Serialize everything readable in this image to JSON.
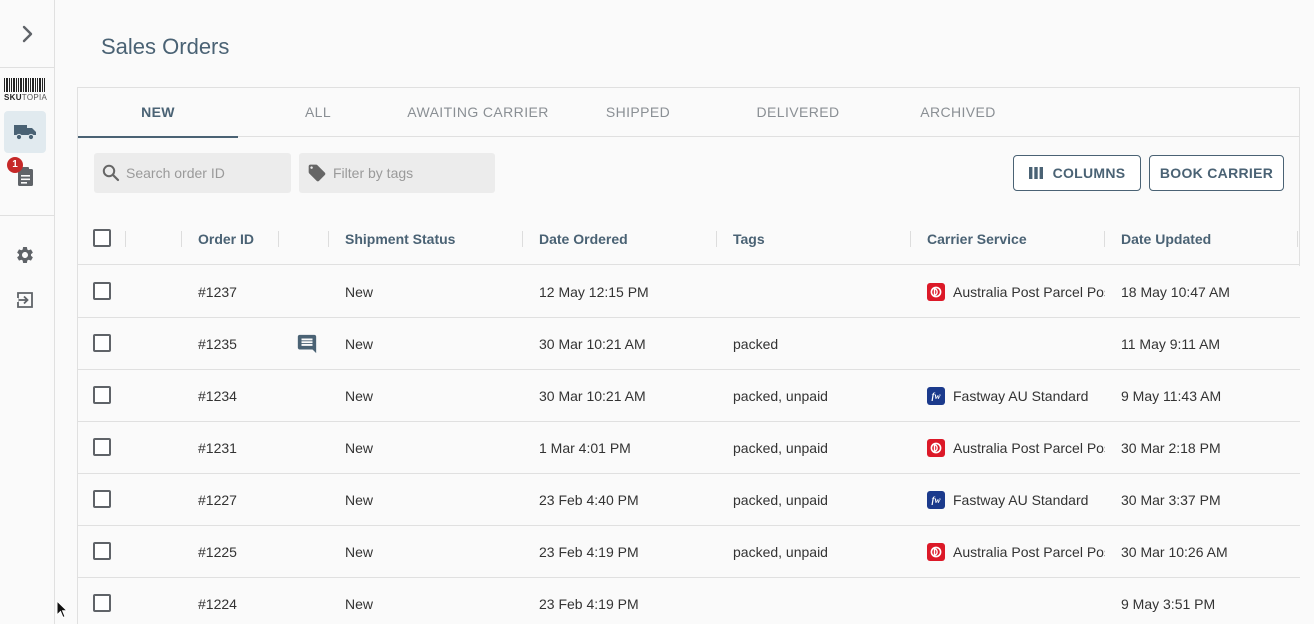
{
  "brand": {
    "name_bold": "SKU",
    "name_light": "TOPIA",
    "badge_count": "1"
  },
  "page": {
    "title": "Sales Orders"
  },
  "tabs": [
    {
      "label": "New",
      "active": true
    },
    {
      "label": "All",
      "active": false
    },
    {
      "label": "Awaiting Carrier",
      "active": false
    },
    {
      "label": "Shipped",
      "active": false
    },
    {
      "label": "Delivered",
      "active": false
    },
    {
      "label": "Archived",
      "active": false
    }
  ],
  "toolbar": {
    "search_placeholder": "Search order ID",
    "tags_placeholder": "Filter by tags",
    "columns_label": "COLUMNS",
    "book_carrier_label": "BOOK CARRIER"
  },
  "table": {
    "headers": {
      "order_id": "Order ID",
      "shipment_status": "Shipment Status",
      "date_ordered": "Date Ordered",
      "tags": "Tags",
      "carrier_service": "Carrier Service",
      "date_updated": "Date Updated"
    },
    "rows": [
      {
        "order_id": "#1237",
        "has_comment": false,
        "status": "New",
        "date_ordered": "12 May 12:15 PM",
        "tags": "",
        "carrier": "auspost",
        "carrier_service": "Australia Post Parcel Post",
        "date_updated": "18 May 10:47 AM"
      },
      {
        "order_id": "#1235",
        "has_comment": true,
        "status": "New",
        "date_ordered": "30 Mar 10:21 AM",
        "tags": "packed",
        "carrier": "",
        "carrier_service": "",
        "date_updated": "11 May 9:11 AM"
      },
      {
        "order_id": "#1234",
        "has_comment": false,
        "status": "New",
        "date_ordered": "30 Mar 10:21 AM",
        "tags": "packed, unpaid",
        "carrier": "fastway",
        "carrier_service": "Fastway AU Standard",
        "date_updated": "9 May 11:43 AM"
      },
      {
        "order_id": "#1231",
        "has_comment": false,
        "status": "New",
        "date_ordered": "1 Mar 4:01 PM",
        "tags": "packed, unpaid",
        "carrier": "auspost",
        "carrier_service": "Australia Post Parcel Post",
        "date_updated": "30 Mar 2:18 PM"
      },
      {
        "order_id": "#1227",
        "has_comment": false,
        "status": "New",
        "date_ordered": "23 Feb 4:40 PM",
        "tags": "packed, unpaid",
        "carrier": "fastway",
        "carrier_service": "Fastway AU Standard",
        "date_updated": "30 Mar 3:37 PM"
      },
      {
        "order_id": "#1225",
        "has_comment": false,
        "status": "New",
        "date_ordered": "23 Feb 4:19 PM",
        "tags": "packed, unpaid",
        "carrier": "auspost",
        "carrier_service": "Australia Post Parcel Post",
        "date_updated": "30 Mar 10:26 AM"
      },
      {
        "order_id": "#1224",
        "has_comment": false,
        "status": "New",
        "date_ordered": "23 Feb 4:19 PM",
        "tags": "",
        "carrier": "",
        "carrier_service": "",
        "date_updated": "9 May 3:51 PM"
      }
    ]
  },
  "icons": {
    "expand": "chevron-right-icon",
    "barcode": "barcode-logo",
    "orders": "truck-icon",
    "inventory": "clipboard-icon",
    "settings": "gear-icon",
    "logout": "logout-icon",
    "search": "search-icon",
    "tags": "tag-icon",
    "columns": "columns-icon",
    "comment": "comment-icon",
    "fastway_logo_text": "fw"
  },
  "colors": {
    "accent": "#4a6274",
    "auspost_red": "#dc1928",
    "fastway_blue": "#1b3a8c",
    "badge_red": "#c62828"
  }
}
